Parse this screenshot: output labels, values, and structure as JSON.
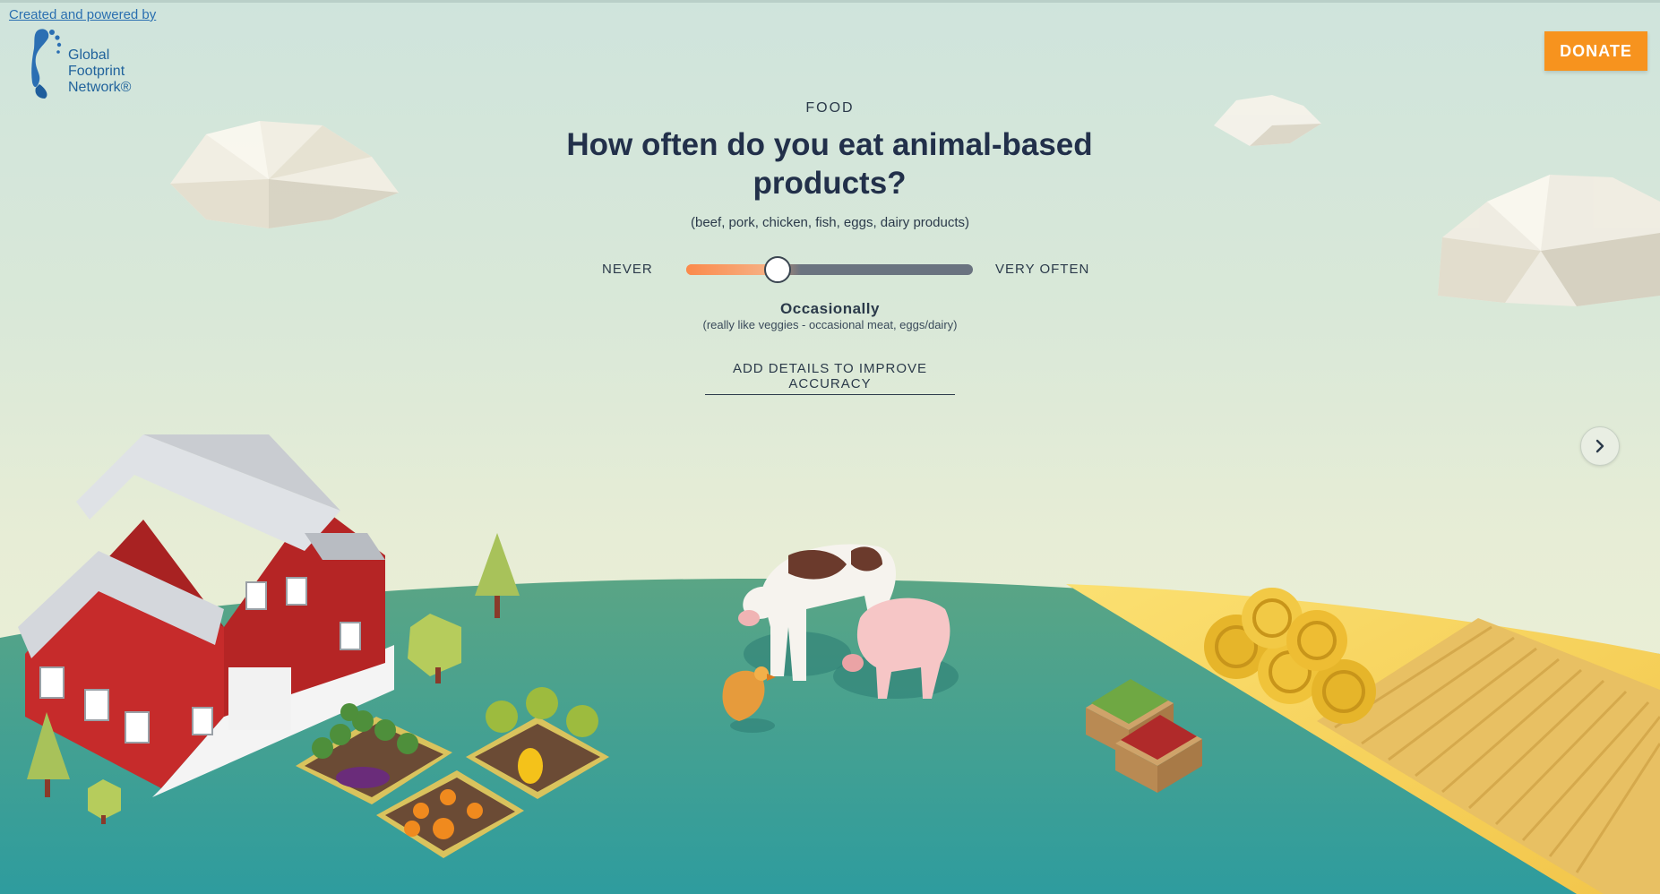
{
  "header": {
    "credit_text": "Created and powered by",
    "logo_lines": [
      "Global",
      "Footprint",
      "Network®"
    ],
    "donate_label": "DONATE"
  },
  "question": {
    "category": "FOOD",
    "title": "How often do you eat animal-based products?",
    "subtitle": "(beef, pork, chicken, fish, eggs, dairy products)"
  },
  "slider": {
    "min_label": "NEVER",
    "max_label": "VERY OFTEN",
    "value_fraction": 0.32,
    "value_label": "Occasionally",
    "value_description": "(really like veggies - occasional meat, eggs/dairy)"
  },
  "actions": {
    "details_link": "ADD DETAILS TO IMPROVE ACCURACY",
    "next_icon": "chevron-right-icon"
  },
  "colors": {
    "accent": "#f7931e",
    "slider_warm": "#fb8a4b",
    "slider_cool": "#6a7380",
    "brand_blue": "#21639c",
    "ground": "#3f9a8a",
    "field": "#f5d35a"
  }
}
